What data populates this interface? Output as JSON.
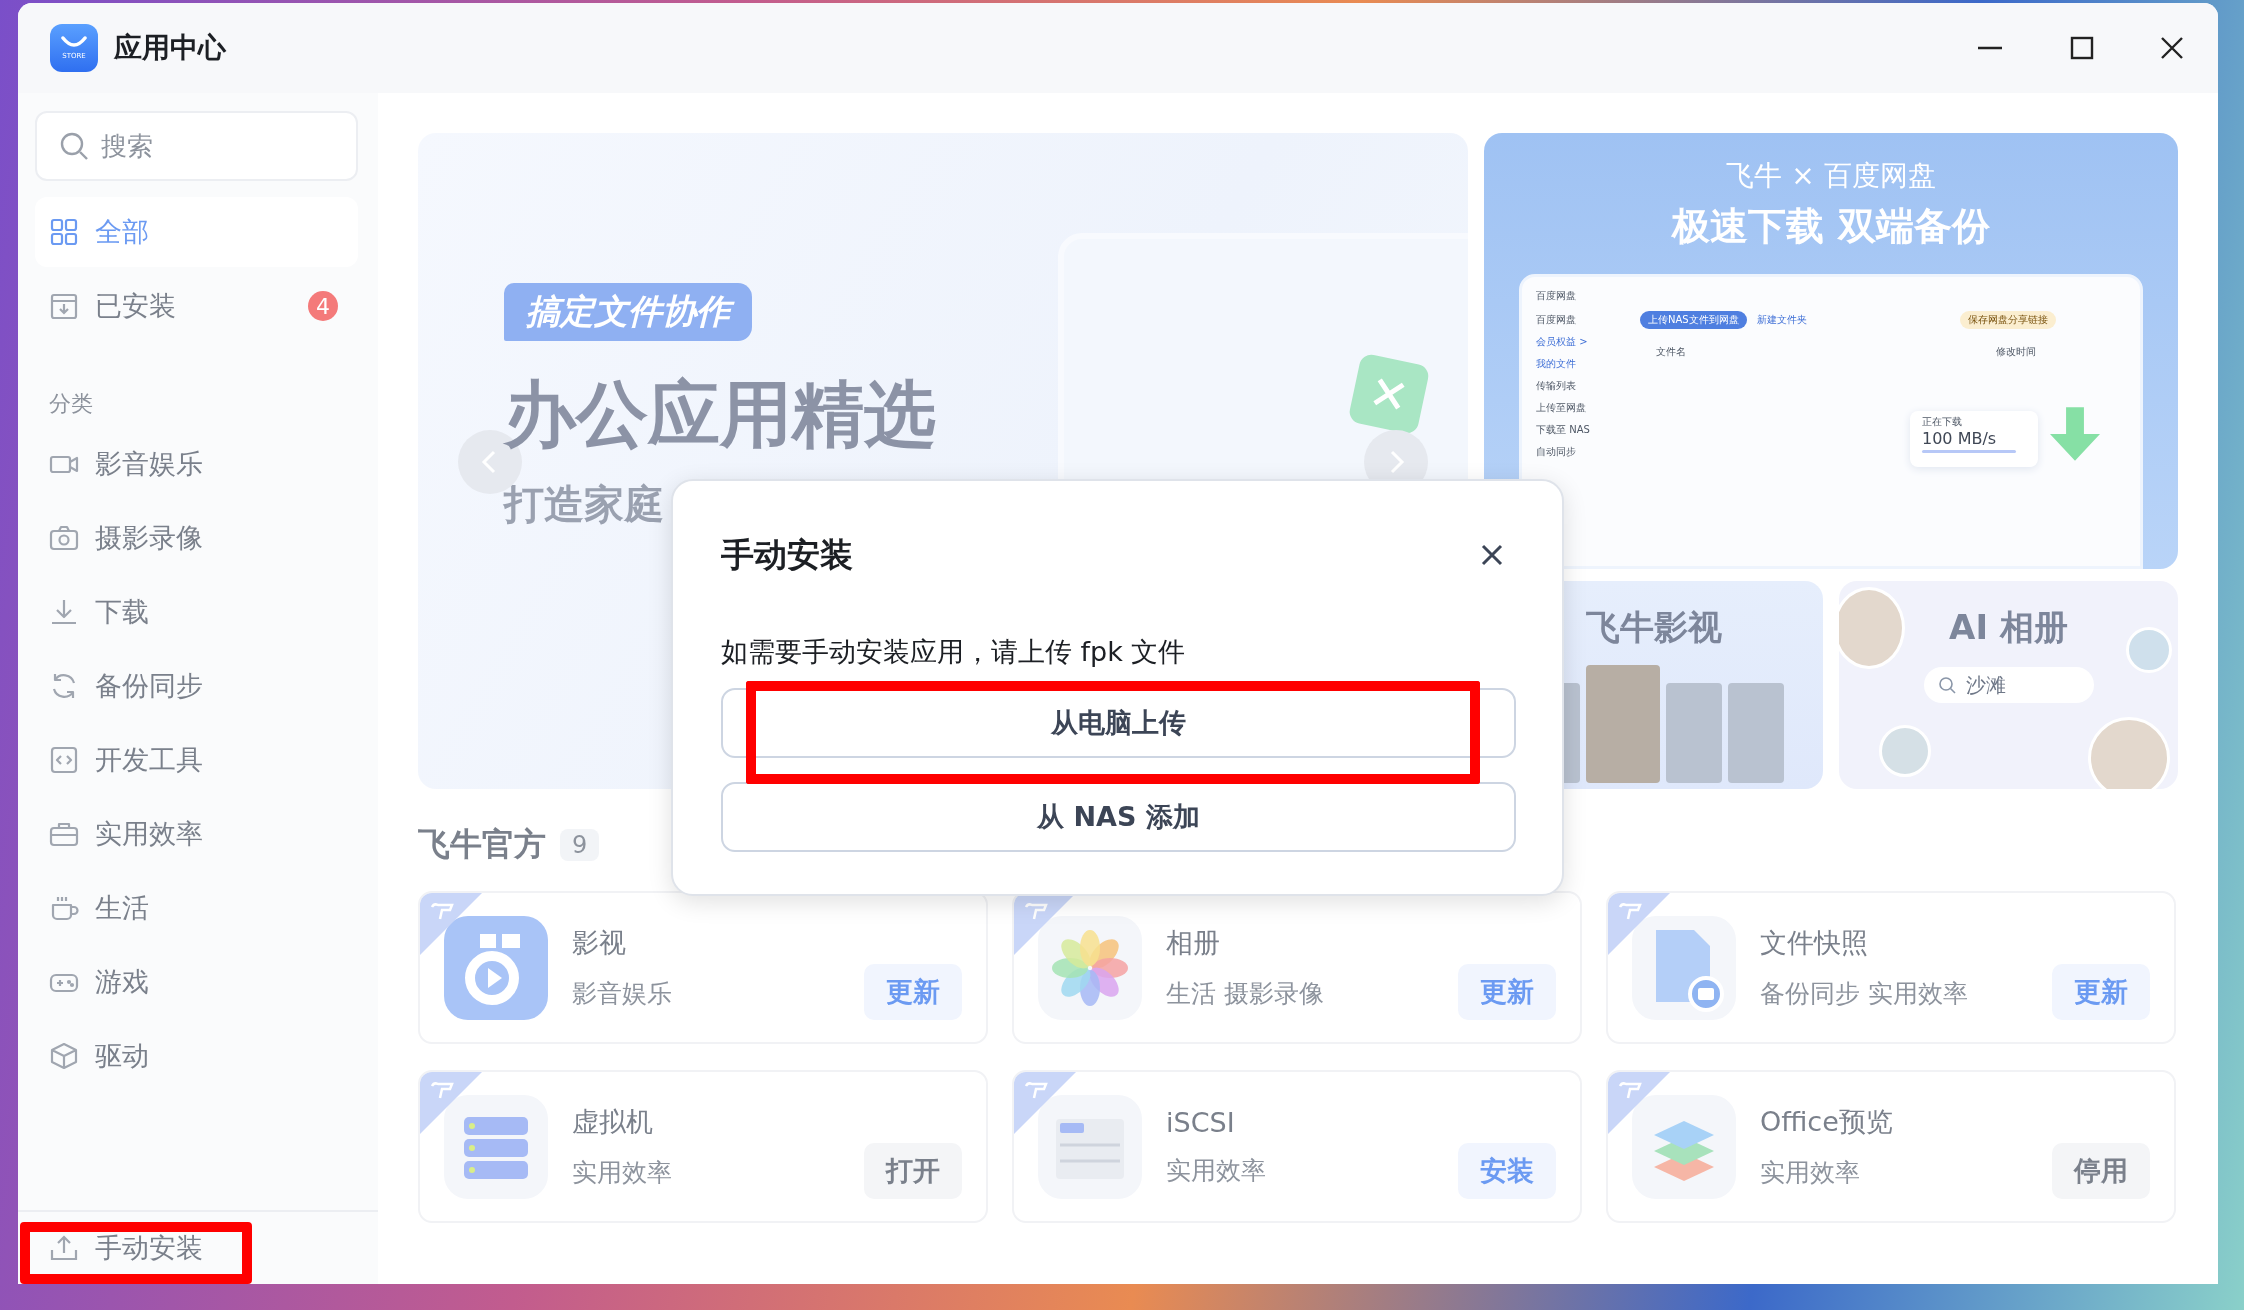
{
  "window": {
    "title": "应用中心",
    "logo_text": "STORE"
  },
  "sidebar": {
    "search": {
      "placeholder": "搜索"
    },
    "items": [
      {
        "label": "全部",
        "selected": true
      },
      {
        "label": "已安装",
        "selected": false,
        "badge": "4"
      }
    ],
    "section_label": "分类",
    "categories": [
      {
        "label": "影音娱乐",
        "selected": false
      },
      {
        "label": "摄影录像",
        "selected": false
      },
      {
        "label": "下载",
        "selected": false
      },
      {
        "label": "备份同步",
        "selected": false
      },
      {
        "label": "开发工具",
        "selected": false
      },
      {
        "label": "实用效率",
        "selected": false
      },
      {
        "label": "生活",
        "selected": false
      },
      {
        "label": "游戏",
        "selected": false
      },
      {
        "label": "驱动",
        "selected": false
      }
    ],
    "footer": {
      "label": "手动安装"
    }
  },
  "promo_main": {
    "tag": "搞定文件协作",
    "headline": "办公应用精选",
    "subline": "打造家庭"
  },
  "promo_baidu": {
    "brand_line": "飞牛 × 百度网盘",
    "headline": "极速下载 双端备份",
    "mock": {
      "title": "百度网盘",
      "account": "百度网盘",
      "member": "会员权益 >",
      "nav": [
        "我的文件",
        "传输列表",
        "上传至网盘",
        "下载至 NAS",
        "自动同步"
      ],
      "toolbar": [
        "上传NAS文件到网盘",
        "新建文件夹"
      ],
      "share": "保存网盘分享链接",
      "columns": [
        "文件名",
        "修改时间"
      ],
      "speed_label": "正在下载",
      "speed": "100 MB/s"
    }
  },
  "promo_video": {
    "title": "飞牛影视"
  },
  "promo_album": {
    "title": "AI 相册",
    "search": "沙滩"
  },
  "section": {
    "title": "飞牛官方",
    "count": "9"
  },
  "apps": [
    {
      "name": "影视",
      "tags": "影音娱乐",
      "action": {
        "label": "更新",
        "kind": "primary"
      }
    },
    {
      "name": "相册",
      "tags": "生活 摄影录像",
      "action": {
        "label": "更新",
        "kind": "primary"
      }
    },
    {
      "name": "文件快照",
      "tags": "备份同步 实用效率",
      "action": {
        "label": "更新",
        "kind": "primary"
      }
    },
    {
      "name": "虚拟机",
      "tags": "实用效率",
      "action": {
        "label": "打开",
        "kind": "plain"
      }
    },
    {
      "name": "iSCSI",
      "tags": "实用效率",
      "action": {
        "label": "安装",
        "kind": "primary"
      }
    },
    {
      "name": "Office预览",
      "tags": "实用效率",
      "action": {
        "label": "停用",
        "kind": "plain"
      }
    }
  ],
  "dialog": {
    "title": "手动安装",
    "message": "如需要手动安装应用，请上传 fpk 文件",
    "buttons": [
      "从电脑上传",
      "从 NAS 添加"
    ]
  }
}
